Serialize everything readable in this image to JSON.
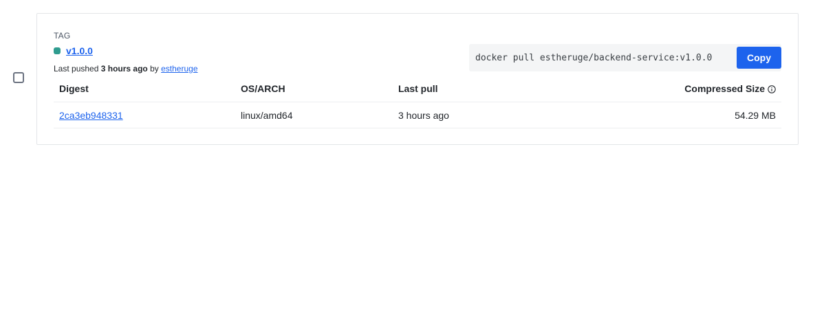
{
  "tag": {
    "section_label": "TAG",
    "name": "v1.0.0",
    "status_color": "#2f9c8f",
    "pushed_prefix": "Last pushed",
    "pushed_time": "3 hours ago",
    "pushed_by_word": "by",
    "pushed_by_user": "estheruge"
  },
  "pull": {
    "command": "docker pull estheruge/backend-service:v1.0.0",
    "copy_label": "Copy"
  },
  "table": {
    "headers": {
      "digest": "Digest",
      "os_arch": "OS/ARCH",
      "last_pull": "Last pull",
      "compressed_size": "Compressed Size"
    },
    "rows": [
      {
        "digest": "2ca3eb948331",
        "os_arch": "linux/amd64",
        "last_pull": "3 hours ago",
        "compressed_size": "54.29 MB"
      }
    ]
  },
  "icons": {
    "info": "info-icon",
    "checkbox": "checkbox-icon"
  },
  "colors": {
    "accent": "#1d63ed",
    "status": "#2f9c8f"
  }
}
